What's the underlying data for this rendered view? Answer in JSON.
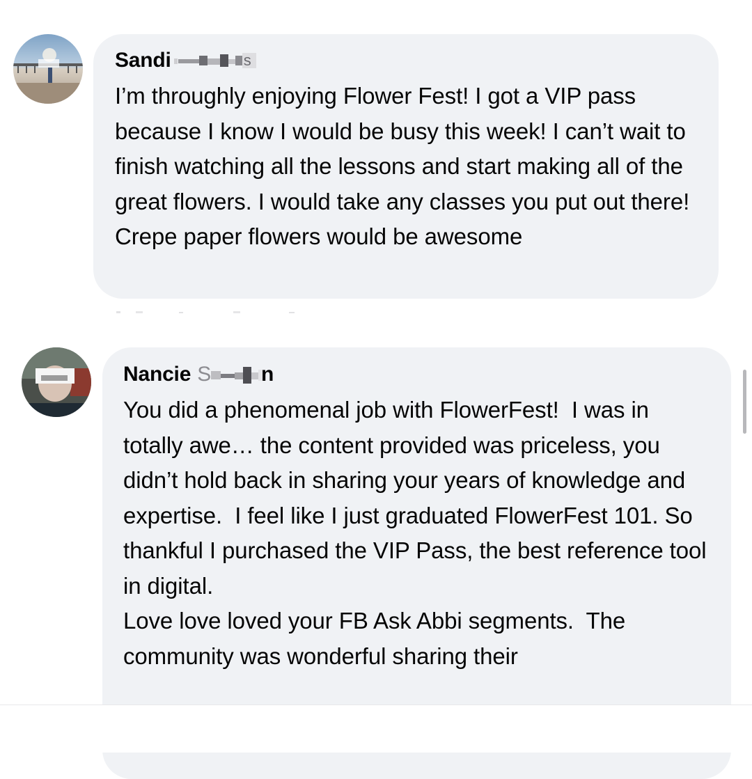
{
  "comments": [
    {
      "author_visible": "Sandi",
      "author_suffix": "s",
      "text": "I’m throughly enjoying Flower Fest! I got a VIP pass because I know I would be busy this week! I can’t wait to finish watching all the lessons and start making all of the great flowers. I would take any classes you put out there! Crepe paper flowers would be awesome"
    },
    {
      "author_visible": "Nancie",
      "author_prefix": "S",
      "author_suffix": "n",
      "text": "You did a phenomenal job with FlowerFest!  I was in totally awe… the content provided was priceless, you didn’t hold back in sharing your years of knowledge and expertise.  I feel like I just graduated FlowerFest 101. So thankful I purchased the VIP Pass, the best reference tool in digital.\nLove love loved your FB Ask Abbi segments.  The community was wonderful sharing their"
    }
  ],
  "icons": {
    "avatar_1": "beach-pier-photo",
    "avatar_2": "person-photo"
  },
  "colors": {
    "bubble": "#f0f2f5",
    "text": "#050505",
    "scrollbar": "#b8b8bb"
  }
}
